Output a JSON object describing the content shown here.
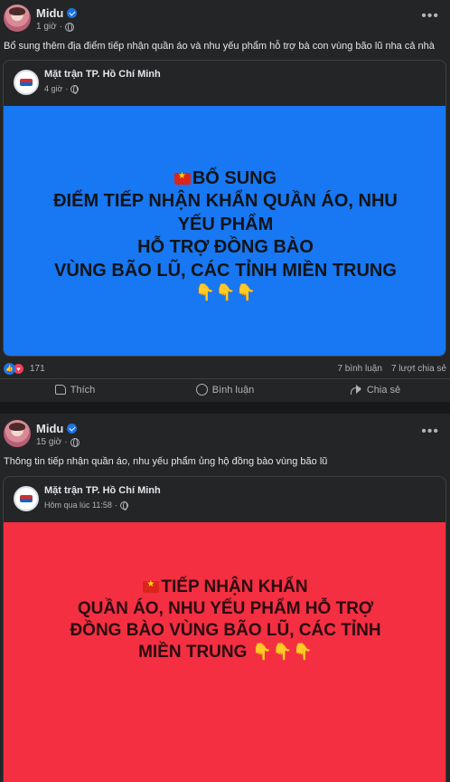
{
  "posts": [
    {
      "author": "Midu",
      "time": "1 giờ",
      "caption": "Bổ sung thêm địa điểm tiếp nhận quần áo và nhu yếu phẩm hỗ trợ bà con vùng bão lũ nha cả nhà",
      "shared": {
        "page_name": "Mặt trận TP. Hồ Chí Minh",
        "time": "4 giờ",
        "banner_lines": [
          "BỔ SUNG",
          "ĐIỂM TIẾP NHẬN KHẨN QUẦN ÁO, NHU",
          "YẾU PHẨM",
          "HỖ TRỢ ĐỒNG BÀO",
          "VÙNG BÃO LŨ, CÁC TỈNH MIỀN TRUNG"
        ],
        "banner_pointers": "👇👇👇",
        "banner_color": "#1877f2"
      },
      "reaction_count": "171",
      "comments": "7 bình luận",
      "shares": "7 lượt chia sẻ",
      "actions": {
        "like": "Thích",
        "comment": "Bình luận",
        "share": "Chia sẻ"
      }
    },
    {
      "author": "Midu",
      "time": "15 giờ",
      "caption": "Thông tin tiếp nhận quần áo, nhu yếu phẩm ủng hộ đồng bào vùng bão lũ",
      "shared": {
        "page_name": "Mặt trận TP. Hồ Chí Minh",
        "time": "Hôm qua lúc 11:58",
        "banner_lines": [
          "TIẾP NHẬN KHẨN",
          "QUẦN ÁO, NHU YẾU PHẨM HỖ TRỢ",
          "ĐỒNG BÀO VÙNG BÃO LŨ, CÁC TỈNH",
          "MIỀN TRUNG"
        ],
        "banner_pointers": "👇👇👇",
        "banner_color": "#f42f42"
      }
    }
  ]
}
